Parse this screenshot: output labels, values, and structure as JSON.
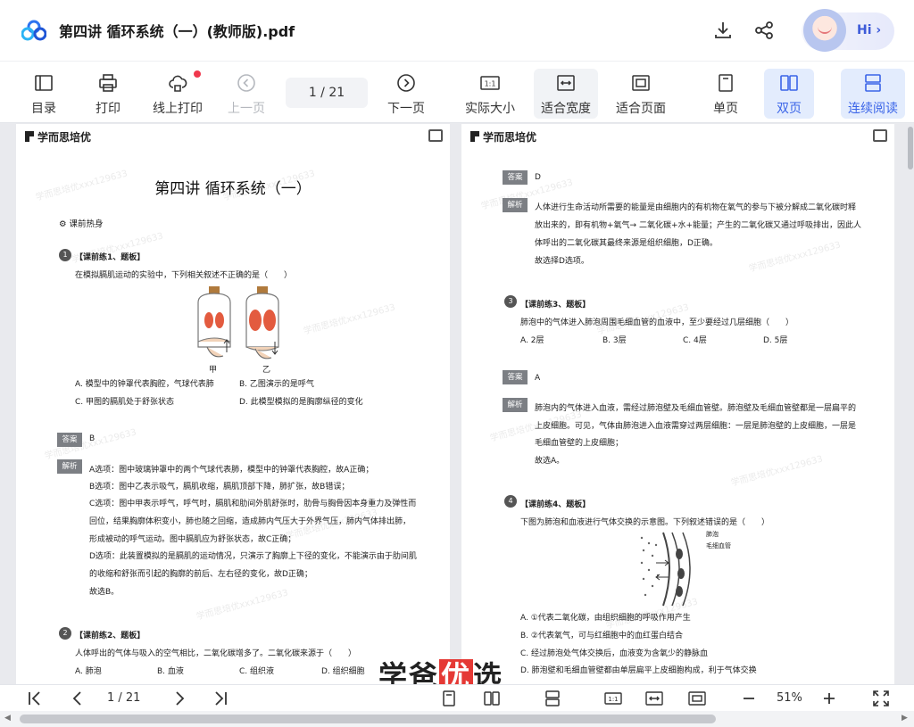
{
  "header": {
    "title": "第四讲 循环系统（一）(教师版).pdf",
    "hi_label": "Hi"
  },
  "toolbar": {
    "toc": "目录",
    "print": "打印",
    "online_print": "线上打印",
    "prev_page": "上一页",
    "page_indicator": "1  / 21",
    "next_page": "下一页",
    "actual_size": "实际大小",
    "fit_width": "适合宽度",
    "fit_page": "适合页面",
    "single_page": "单页",
    "double_page": "双页",
    "continuous": "连续阅读"
  },
  "page_left": {
    "brand": "学而思培优",
    "lesson_title": "第四讲 循环系统（一）",
    "warmup": "课前热身",
    "q1": {
      "num": "1",
      "label": "【课前练1、题板】",
      "stem": "在模拟膈肌运动的实验中，下列相关叙述不正确的是（　　）",
      "fig_a": "甲",
      "fig_b": "乙",
      "opt_a": "A. 模型中的钟罩代表胸腔，气球代表肺",
      "opt_b": "B. 乙图演示的是呼气",
      "opt_c": "C. 甲图的膈肌处于舒张状态",
      "opt_d": "D. 此模型模拟的是胸廓纵径的变化"
    },
    "answer_tag": "答案",
    "answer_val": "B",
    "analysis_tag": "解析",
    "analysis": [
      "A选项：图中玻璃钟罩中的两个气球代表肺，模型中的钟罩代表胸腔，故A正确；",
      "B选项：图中乙表示吸气，膈肌收缩，膈肌顶部下降，肺扩张，故B错误；",
      "C选项：图中甲表示呼气，呼气时，膈肌和肋间外肌舒张时，肋骨与胸骨因本身重力及弹性而",
      "回位，结果胸廓体积变小，肺也随之回缩，造成肺内气压大于外界气压，肺内气体排出肺，",
      "形成被动的呼气运动。图中膈肌应为舒张状态，故C正确；",
      "D选项：此装置模拟的是膈肌的运动情况，只演示了胸廓上下径的变化，不能演示由于肋间肌",
      "的收缩和舒张而引起的胸廓的前后、左右径的变化，故D正确；",
      "故选B。"
    ],
    "q2": {
      "num": "2",
      "label": "【课前练2、题板】",
      "stem": "人体呼出的气体与吸入的空气相比，二氧化碳增多了。二氧化碳来源于（　　）",
      "opt_a": "A. 肺泡",
      "opt_b": "B. 血液",
      "opt_c": "C. 组织液",
      "opt_d": "D. 组织细胞"
    }
  },
  "page_right": {
    "brand": "学而思培优",
    "answer_tag": "答案",
    "a2_val": "D",
    "analysis_tag": "解析",
    "a2_analysis": [
      "人体进行生命活动所需要的能量是由细胞内的有机物在氧气的参与下被分解成二氧化碳时释",
      "放出来的，即有机物+氧气→ 二氧化碳+水+能量；产生的二氧化碳又通过呼吸排出，因此人",
      "体呼出的二氧化碳其最终来源是组织细胞，D正确。",
      "故选择D选项。"
    ],
    "q3": {
      "num": "3",
      "label": "【课前练3、题板】",
      "stem": "肺泡中的气体进入肺泡周围毛细血管的血液中，至少要经过几层细胞（　　）",
      "opt_a": "A. 2层",
      "opt_b": "B. 3层",
      "opt_c": "C. 4层",
      "opt_d": "D. 5层"
    },
    "a3_val": "A",
    "a3_analysis": [
      "肺泡内的气体进入血液，需经过肺泡壁及毛细血管壁。肺泡壁及毛细血管壁都是一层扁平的",
      "上皮细胞。可见，气体由肺泡进入血液需穿过两层细胞：一层是肺泡壁的上皮细胞，一层是",
      "毛细血管壁的上皮细胞；",
      "故选A。"
    ],
    "q4": {
      "num": "4",
      "label": "【课前练4、题板】",
      "stem": "下图为肺泡和血液进行气体交换的示意图。下列叙述错误的是（　　）",
      "fig_label_1": "肺泡",
      "fig_label_2": "毛细血管",
      "opt_a": "A. ①代表二氧化碳，由组织细胞的呼吸作用产生",
      "opt_b": "B. ②代表氧气，可与红细胞中的血红蛋白结合",
      "opt_c": "C. 经过肺泡处气体交换后，血液变为含氧少的静脉血",
      "opt_d": "D. 肺泡壁和毛细血管壁都由单层扁平上皮细胞构成，利于气体交换"
    }
  },
  "watermark": "学而思培优xxx129633",
  "brand_overlay": {
    "pre": "学爸",
    "highlight": "优",
    "post": "选"
  },
  "bottombar": {
    "page_indicator": "1  / 21",
    "zoom": "51%"
  },
  "colors": {
    "accent": "#3a64e8",
    "active_bg": "#e3ecfd",
    "notification": "#f0384d"
  }
}
